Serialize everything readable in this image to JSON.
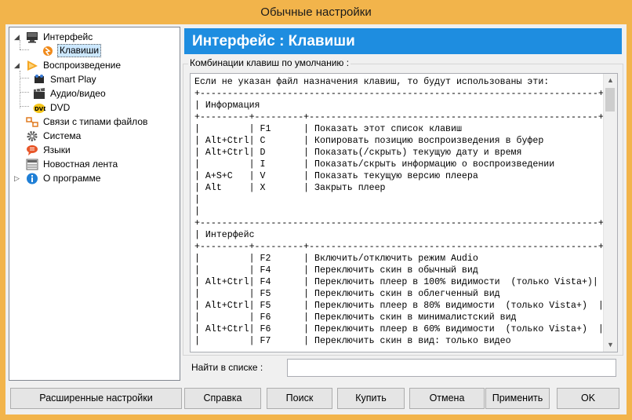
{
  "window": {
    "title": "Обычные настройки"
  },
  "tree": {
    "items": [
      {
        "label": "Интерфейс"
      },
      {
        "label": "Клавиши"
      },
      {
        "label": "Воспроизведение"
      },
      {
        "label": "Smart Play"
      },
      {
        "label": "Аудио/видео"
      },
      {
        "label": "DVD"
      },
      {
        "label": "Связи с типами файлов"
      },
      {
        "label": "Система"
      },
      {
        "label": "Языки"
      },
      {
        "label": "Новостная лента"
      },
      {
        "label": "О программе"
      }
    ]
  },
  "panel": {
    "header": "Интерфейс : Клавиши",
    "group_title": "Комбинации клавиш по умолчанию :",
    "text_lines": [
      "Если не указан файл назначения клавиш, то будут использованы эти:",
      "+-------------------------------------------------------------------------+",
      "| Информация                                                               |",
      "+---------+---------+-----------------------------------------------------+",
      "|         | F1      | Показать этот список клавиш                          |",
      "| Alt+Ctrl| C       | Копировать позицию воспроизведения в буфер           |",
      "| Alt+Ctrl| D       | Показать(/скрыть) текущую дату и время               |",
      "|         | I       | Показать/скрыть информацию о воспроизведении         |",
      "| A+S+C   | V       | Показать текущую версию плеера                       |",
      "| Alt     | X       | Закрыть плеер                                        |",
      "|                                                                          |",
      "|                                                                          |",
      "+-------------------------------------------------------------------------+",
      "| Интерфейс                                                                |",
      "+---------+---------+-----------------------------------------------------+",
      "|         | F2      | Включить/отключить режим Audio                       |",
      "|         | F4      | Переключить скин в обычный вид                       |",
      "| Alt+Ctrl| F4      | Переключить плеер в 100% видимости  (только Vista+)|",
      "|         | F5      | Переключить скин в облегченный вид                   |",
      "| Alt+Ctrl| F5      | Переключить плеер в 80% видимости  (только Vista+)  |",
      "|         | F6      | Переключить скин в минималистский вид                |",
      "| Alt+Ctrl| F6      | Переключить плеер в 60% видимости  (только Vista+)  |",
      "|         | F7      | Переключить скин в вид: только видео                 |"
    ],
    "find_label": "Найти в списке :",
    "find_value": ""
  },
  "buttons": {
    "advanced": "Расширенные настройки",
    "help": "Справка",
    "search": "Поиск",
    "buy": "Купить",
    "cancel": "Отмена",
    "apply": "Применить",
    "ok": "OK"
  },
  "colors": {
    "accent": "#1e8de0",
    "titlebar": "#f2b44b"
  }
}
